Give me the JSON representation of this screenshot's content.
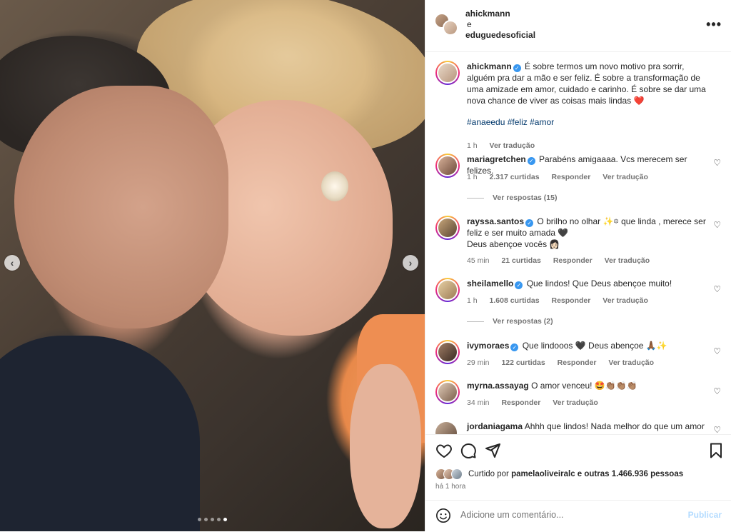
{
  "post": {
    "author1": "ahickmann",
    "connector": "e",
    "author2": "eduguedesoficial",
    "caption_user": "ahickmann",
    "caption_text": "É sobre termos um novo motivo pra sorrir, alguém pra dar a mão e ser feliz. É sobre a transformação de uma amizade em amor, cuidado e carinho. É sobre se dar uma nova chance de viver as coisas mais lindas ❤️",
    "hashtags": [
      "#anaeedu",
      "#feliz",
      "#amor"
    ],
    "caption_time": "1 h",
    "translate": "Ver tradução"
  },
  "comments": [
    {
      "user": "mariagretchen",
      "text": "Parabéns amigaaaa. Vcs merecem ser felizes.",
      "time": "1 h",
      "likes": "2.317 curtidas",
      "reply": "Responder",
      "translate": "Ver tradução",
      "replies": "Ver respostas (15)"
    },
    {
      "user": "rayssa.santos",
      "text": "O brilho no olhar ✨𖡼 que linda , merece ser feliz e ser muito amada 🖤",
      "text2": "Deus abençoe vocês 👩🏻",
      "time": "45 min",
      "likes": "21 curtidas",
      "reply": "Responder",
      "translate": "Ver tradução"
    },
    {
      "user": "sheilamello",
      "text": "Que lindos! Que Deus abençoe muito!",
      "time": "1 h",
      "likes": "1.608 curtidas",
      "reply": "Responder",
      "translate": "Ver tradução",
      "replies": "Ver respostas (2)"
    },
    {
      "user": "ivymoraes",
      "text": "Que lindooos 🖤 Deus abençoe 🙏🏾✨",
      "time": "29 min",
      "likes": "122 curtidas",
      "reply": "Responder",
      "translate": "Ver tradução"
    },
    {
      "user": "myrna.assayag",
      "text": "O amor venceu! 🤩👏🏽👏🏽👏🏽",
      "time": "34 min",
      "reply": "Responder",
      "translate": "Ver tradução"
    },
    {
      "user": "jordaniagama",
      "text": "Ahhh que lindos! Nada melhor do que um amor"
    }
  ],
  "likes": {
    "prefix": "Curtido por",
    "user": "pamelaoliveiralc",
    "suffix": "e outras 1.466.936 pessoas"
  },
  "posted": "há 1 hora",
  "add_comment": {
    "placeholder": "Adicione um comentário...",
    "publish": "Publicar"
  },
  "carousel": {
    "count": 5,
    "active_index": 4
  },
  "icons": [
    "more-icon",
    "heart-icon",
    "comment-icon",
    "share-icon",
    "bookmark-icon",
    "emoji-icon",
    "prev-icon",
    "next-icon",
    "verified-icon"
  ]
}
